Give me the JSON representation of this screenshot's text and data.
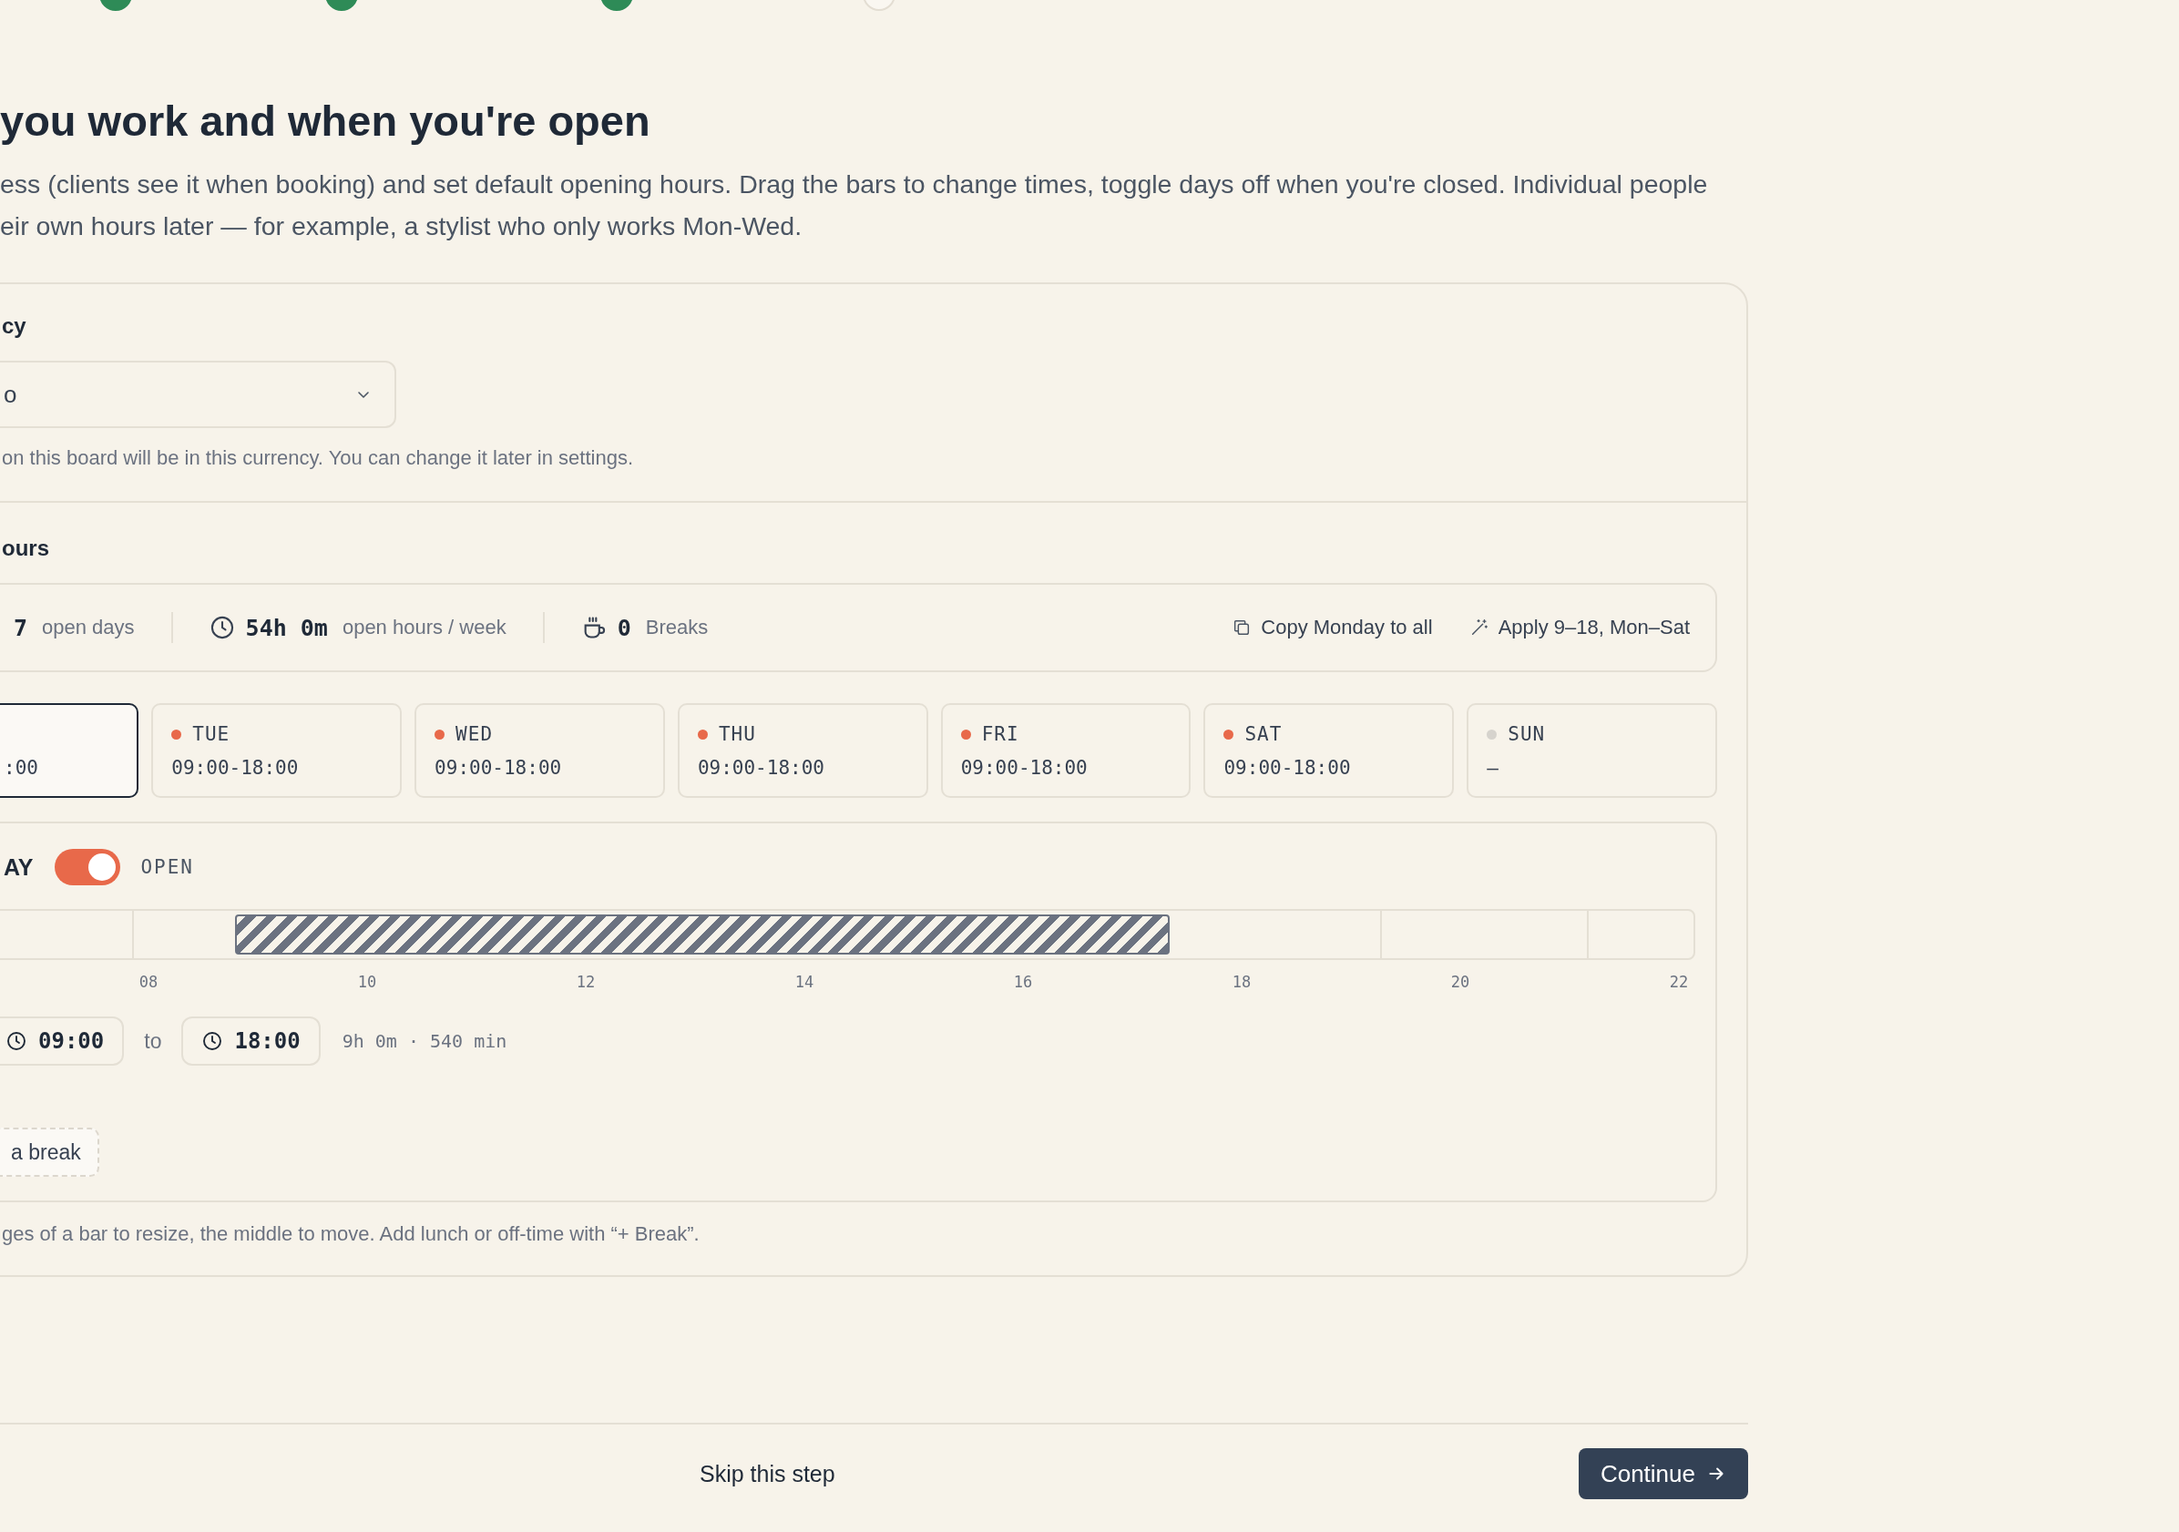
{
  "steps": [
    {
      "done": true
    },
    {
      "done": true
    },
    {
      "done": true
    },
    {
      "done": false
    }
  ],
  "heading": "you work and when you're open",
  "intro_lines": [
    "ess (clients see it when booking) and set default opening hours. Drag the bars to change times, toggle days off when you're closed. Individual people",
    "eir own hours later — for example, a stylist who only works Mon-Wed."
  ],
  "currency": {
    "label": "cy",
    "value": "o",
    "help": "on this board will be in this currency. You can change it later in settings."
  },
  "hours": {
    "label": "ours",
    "stats": [
      {
        "kind": "days",
        "value": "7",
        "label": "open days"
      },
      {
        "kind": "hours",
        "value": "54h 0m",
        "label": "open hours / week"
      },
      {
        "kind": "breaks",
        "value": "0",
        "label": "Breaks"
      }
    ],
    "actions": [
      {
        "kind": "copy",
        "label": "Copy Monday to all"
      },
      {
        "kind": "apply",
        "label": "Apply 9–18, Mon–Sat"
      }
    ],
    "days": [
      {
        "hours": ":00",
        "selected": true
      },
      {
        "label": "TUE",
        "hours": "09:00-18:00",
        "open": true,
        "selected": false
      },
      {
        "label": "WED",
        "hours": "09:00-18:00",
        "open": true,
        "selected": false
      },
      {
        "label": "THU",
        "hours": "09:00-18:00",
        "open": true,
        "selected": false
      },
      {
        "label": "FRI",
        "hours": "09:00-18:00",
        "open": true,
        "selected": false
      },
      {
        "label": "SAT",
        "hours": "09:00-18:00",
        "open": true,
        "selected": false
      },
      {
        "label": "SUN",
        "hours": "–",
        "open": false,
        "selected": false
      }
    ],
    "detail": {
      "day": "AY",
      "open": true,
      "status": "OPEN",
      "ticks": [
        "08",
        "10",
        "12",
        "14",
        "16",
        "18",
        "20",
        "22"
      ],
      "from": "09:00",
      "to_label": "to",
      "to": "18:00",
      "duration": "9h 0m · 540 min",
      "add_break": "a break"
    },
    "hint": "ges of a bar to resize, the middle to move. Add lunch or off-time with “+ Break”."
  },
  "footer": {
    "skip": "Skip this step",
    "continue": "Continue"
  }
}
